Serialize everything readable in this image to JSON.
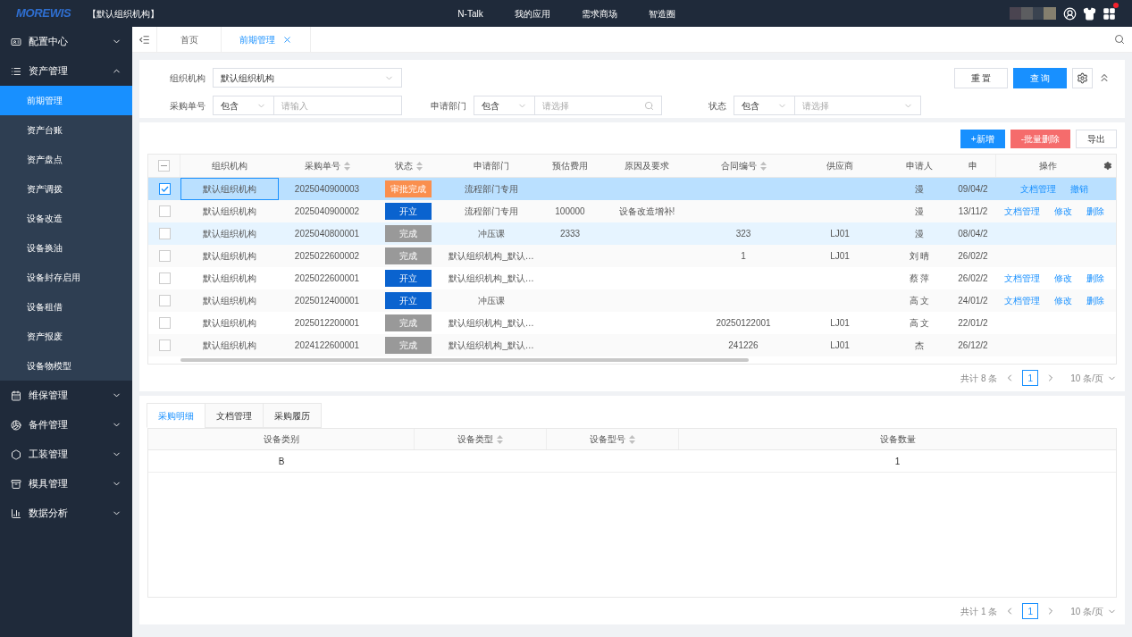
{
  "header": {
    "logo": "MOREWIS",
    "org": "【默认组织机构】",
    "nav": [
      "N-Talk",
      "我的应用",
      "需求商场",
      "智造圈"
    ],
    "notification": true
  },
  "sidebar": {
    "items": [
      {
        "label": "配置中心",
        "expanded": false,
        "selected": false
      },
      {
        "label": "资产管理",
        "expanded": true,
        "selected": false,
        "children": [
          {
            "label": "前期管理",
            "selected": true
          },
          {
            "label": "资产台账",
            "selected": false
          },
          {
            "label": "资产盘点",
            "selected": false
          },
          {
            "label": "资产调拨",
            "selected": false
          },
          {
            "label": "设备改造",
            "selected": false
          },
          {
            "label": "设备换油",
            "selected": false
          },
          {
            "label": "设备封存启用",
            "selected": false
          },
          {
            "label": "设备租借",
            "selected": false
          },
          {
            "label": "资产报废",
            "selected": false
          },
          {
            "label": "设备物模型",
            "selected": false
          }
        ]
      },
      {
        "label": "维保管理",
        "expanded": false,
        "selected": false
      },
      {
        "label": "备件管理",
        "expanded": false,
        "selected": false
      },
      {
        "label": "工装管理",
        "expanded": false,
        "selected": false
      },
      {
        "label": "模具管理",
        "expanded": false,
        "selected": false
      },
      {
        "label": "数据分析",
        "expanded": false,
        "selected": false
      }
    ]
  },
  "tabs": [
    {
      "label": "首页",
      "selected": false,
      "closable": false
    },
    {
      "label": "前期管理",
      "selected": true,
      "closable": true
    }
  ],
  "filters": {
    "org": {
      "label": "组织机构",
      "value": "默认组织机构"
    },
    "po": {
      "label": "采购单号",
      "op": "包含",
      "placeholder": "请输入"
    },
    "dept": {
      "label": "申请部门",
      "op": "包含",
      "placeholder": "请选择"
    },
    "status": {
      "label": "状态",
      "op": "包含",
      "placeholder": "请选择"
    },
    "buttons": [
      "重 置",
      "查 询"
    ]
  },
  "actions": [
    {
      "label": "+新增",
      "kind": "primary"
    },
    {
      "label": "-批量删除",
      "kind": "danger"
    },
    {
      "label": "导出",
      "kind": "default"
    }
  ],
  "table": {
    "select_all_indeterminate": true,
    "columns": [
      {
        "label": "组织机构",
        "sortable": false
      },
      {
        "label": "采购单号",
        "sortable": true
      },
      {
        "label": "状态",
        "sortable": true
      },
      {
        "label": "申请部门",
        "sortable": false
      },
      {
        "label": "预估费用",
        "sortable": false
      },
      {
        "label": "原因及要求",
        "sortable": false
      },
      {
        "label": "合同编号",
        "sortable": true
      },
      {
        "label": "供应商",
        "sortable": false
      },
      {
        "label": "申请人",
        "sortable": false
      },
      {
        "label": "申",
        "sortable": false
      },
      {
        "label": "操作",
        "sortable": false
      }
    ],
    "rows": [
      {
        "selected": true,
        "hover": false,
        "cells": [
          "默认组织机构",
          "2025040900003",
          "审批完成",
          "流程部门专用",
          "",
          "",
          "",
          "",
          "漫",
          "09/04/2"
        ],
        "color": "#fa8f4e",
        "ops": [
          "文档管理",
          "撤销"
        ]
      },
      {
        "selected": false,
        "hover": false,
        "cells": [
          "默认组织机构",
          "2025040900002",
          "开立",
          "流程部门专用",
          "100000",
          "设备改造增补!",
          "",
          "",
          "漫",
          "13/11/2"
        ],
        "color": "#0a63cf",
        "ops": [
          "文档管理",
          "修改",
          "删除"
        ]
      },
      {
        "selected": false,
        "hover": true,
        "cells": [
          "默认组织机构",
          "2025040800001",
          "完成",
          "冲压课",
          "2333",
          "",
          "323",
          "LJ01",
          "漫",
          "08/04/2"
        ],
        "color": "#999999",
        "ops": []
      },
      {
        "selected": false,
        "hover": false,
        "cells": [
          "默认组织机构",
          "2025022600002",
          "完成",
          "默认组织机构_默认…",
          "",
          "",
          "1",
          "LJ01",
          "刘 晴",
          "26/02/2"
        ],
        "color": "#999999",
        "ops": []
      },
      {
        "selected": false,
        "hover": false,
        "cells": [
          "默认组织机构",
          "2025022600001",
          "开立",
          "默认组织机构_默认…",
          "",
          "",
          "",
          "",
          "蔡 萍",
          "26/02/2"
        ],
        "color": "#0a63cf",
        "ops": [
          "文档管理",
          "修改",
          "删除"
        ]
      },
      {
        "selected": false,
        "hover": false,
        "cells": [
          "默认组织机构",
          "2025012400001",
          "开立",
          "冲压课",
          "",
          "",
          "",
          "",
          "高 文",
          "24/01/2"
        ],
        "color": "#0a63cf",
        "ops": [
          "文档管理",
          "修改",
          "删除"
        ]
      },
      {
        "selected": false,
        "hover": false,
        "cells": [
          "默认组织机构",
          "2025012200001",
          "完成",
          "默认组织机构_默认…",
          "",
          "",
          "20250122001",
          "LJ01",
          "高 文",
          "22/01/2"
        ],
        "color": "#999999",
        "ops": []
      },
      {
        "selected": false,
        "hover": false,
        "cells": [
          "默认组织机构",
          "2024122600001",
          "完成",
          "默认组织机构_默认…",
          "",
          "",
          "241226",
          "LJ01",
          "杰",
          "26/12/2"
        ],
        "color": "#999999",
        "ops": []
      }
    ],
    "pagination": {
      "total": "共计 8 条",
      "page": "1",
      "size": "10 条/页"
    }
  },
  "detail": {
    "tabs": [
      {
        "label": "采购明细",
        "selected": true
      },
      {
        "label": "文档管理",
        "selected": false
      },
      {
        "label": "采购履历",
        "selected": false
      }
    ],
    "columns": [
      {
        "label": "设备类别",
        "sortable": false
      },
      {
        "label": "设备类型",
        "sortable": true
      },
      {
        "label": "设备型号",
        "sortable": true
      },
      {
        "label": "设备数量",
        "sortable": false
      }
    ],
    "rows": [
      [
        "B",
        "",
        "",
        "1"
      ]
    ],
    "pagination": {
      "total": "共计 1 条",
      "page": "1",
      "size": "10 条/页"
    }
  }
}
